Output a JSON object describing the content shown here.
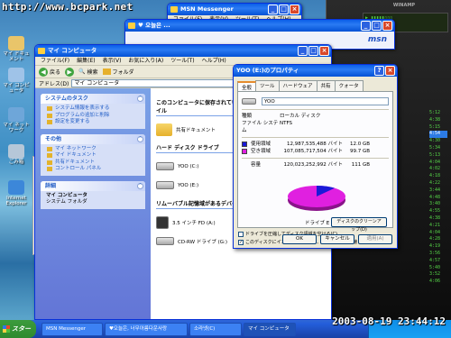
{
  "watermark": "http://www.bcpark.net",
  "desktop": {
    "icons": [
      {
        "label": "マイ ドキュメント",
        "color": "#e9c56a"
      },
      {
        "label": "マイ コンピュータ",
        "color": "#9fc3e8"
      },
      {
        "label": "マイ ネットワーク",
        "color": "#6ea6d9"
      },
      {
        "label": "ごみ箱",
        "color": "#b6c7d8"
      },
      {
        "label": "Internet Explorer",
        "color": "#3c87d9"
      }
    ]
  },
  "back_windows": {
    "msn_title": "MSN Messenger",
    "msn_menu": [
      "ファイル(F)",
      "表示(V)",
      "ツール(T)",
      "ヘルプ(H)"
    ],
    "chat_title": "♥ 오늘은 ...",
    "chat_brand": "msn"
  },
  "side_strip": [
    "3.",
    "3.",
    "3.",
    "1.",
    "1.",
    "1.",
    "1.",
    "1.",
    "1.",
    "1.",
    "1."
  ],
  "explorer": {
    "title": "マイ コンピュータ",
    "menu": [
      "ファイル(F)",
      "編集(E)",
      "表示(V)",
      "お気に入り(A)",
      "ツール(T)",
      "ヘルプ(H)"
    ],
    "toolbar": {
      "back": "戻る",
      "search": "検索",
      "folders": "フォルダ"
    },
    "address_label": "アドレス(D)",
    "address_value": "マイ コンピュータ",
    "tasks": {
      "title": "システムのタスク",
      "items": [
        "システム情報を表示する",
        "プログラムの追加と削除",
        "設定を変更する"
      ]
    },
    "places": {
      "title": "その他",
      "items": [
        "マイ ネットワーク",
        "マイ ドキュメント",
        "共有ドキュメント",
        "コントロール パネル"
      ]
    },
    "details": {
      "title": "詳細",
      "name": "マイ コンピュータ",
      "desc": "システム フォルダ"
    },
    "content": {
      "files_heading": "このコンピュータに保存されているファイル",
      "shared_docs": "共有ドキュメント",
      "hdd_heading": "ハード ディスク ドライブ",
      "drives": [
        "YOO (C:)",
        "YOO (E:)"
      ],
      "removable_heading": "リムーバブル記憶域があるデバイス",
      "removable": [
        "3.5 インチ FD (A:)",
        "CD-RW ドライブ (G:)"
      ]
    }
  },
  "dialog": {
    "title": "YOO (E:)のプロパティ",
    "tabs": [
      "全般",
      "ツール",
      "ハードウェア",
      "共有",
      "クォータ"
    ],
    "drive_name": "YOO",
    "type_label": "種類",
    "type_value": "ローカル ディスク",
    "fs_label": "ファイル システム",
    "fs_value": "NTFS",
    "used_label": "使用領域",
    "used_bytes": "12,987,535,488 バイト",
    "used_gb": "12.0 GB",
    "used_color": "#1a1ad8",
    "free_label": "空き領域",
    "free_bytes": "107,085,717,504 バイト",
    "free_gb": "99.7 GB",
    "free_color": "#e020e0",
    "capacity_label": "容量",
    "capacity_bytes": "120,023,252,992 バイト",
    "capacity_gb": "111 GB",
    "used_fraction": 0.108,
    "drive_label": "ドライブ E",
    "cleanup_button": "ディスクのクリーンアップ(D)",
    "compress_check": "ドライブを圧縮してディスク領域を空ける(C)",
    "index_check": "このディスクにインデックスを付け、ファイル検索を速くする(I)",
    "ok": "OK",
    "cancel": "キャンセル",
    "apply": "適用(A)"
  },
  "media_player": {
    "brand": "WINAMP",
    "list": [
      "5:12",
      "4:38",
      "5:15",
      "4:54",
      "4:30",
      "5:34",
      "5:13",
      "4:04",
      "4:02",
      "4:18",
      "4:22",
      "3:44",
      "4:48",
      "3:40",
      "4:55",
      "4:38",
      "4:21",
      "4:04",
      "4:28",
      "4:19",
      "3:56",
      "4:57",
      "5:40",
      "3:52",
      "4:06"
    ],
    "highlight": 3
  },
  "taskbar": {
    "start": "スタート",
    "tasks": [
      "MSN Messenger",
      "♥오늘은, 너무아름다운사랑",
      "소라넷(C)",
      "マイ コンピュータ"
    ]
  },
  "clock_text": "2003-08-19 23:44:12"
}
